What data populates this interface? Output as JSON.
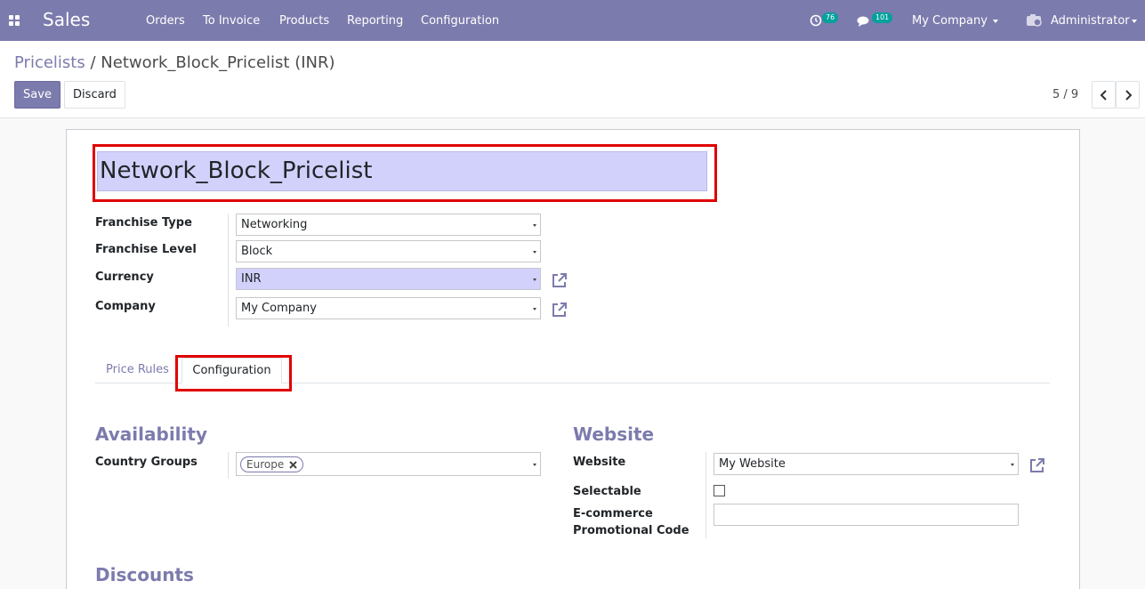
{
  "navbar": {
    "app_name": "Sales",
    "menu": [
      "Orders",
      "To Invoice",
      "Products",
      "Reporting",
      "Configuration"
    ],
    "activity_count": "76",
    "message_count": "101",
    "company": "My Company",
    "user": "Administrator"
  },
  "breadcrumb": {
    "parent": "Pricelists",
    "separator": "/",
    "current": "Network_Block_Pricelist (INR)"
  },
  "toolbar": {
    "save_label": "Save",
    "discard_label": "Discard"
  },
  "pager": {
    "value": "5 / 9"
  },
  "form": {
    "name": "Network_Block_Pricelist",
    "fields": {
      "franchise_type": {
        "label": "Franchise Type",
        "value": "Networking"
      },
      "franchise_level": {
        "label": "Franchise Level",
        "value": "Block"
      },
      "currency": {
        "label": "Currency",
        "value": "INR"
      },
      "company": {
        "label": "Company",
        "value": "My Company"
      }
    }
  },
  "tabs": [
    {
      "label": "Price Rules",
      "active": false
    },
    {
      "label": "Configuration",
      "active": true
    }
  ],
  "availability": {
    "title": "Availability",
    "country_groups_label": "Country Groups",
    "country_group_tag": "Europe"
  },
  "website_section": {
    "title": "Website",
    "website_label": "Website",
    "website_value": "My Website",
    "selectable_label": "Selectable",
    "selectable_checked": false,
    "promo_label_line1": "E-commerce",
    "promo_label_line2": "Promotional Code",
    "promo_value": ""
  },
  "discounts": {
    "title": "Discounts"
  },
  "colors": {
    "brand": "#7c7bad",
    "highlight_field": "#d2d1fb",
    "annotation_red": "#e00000",
    "badge_teal": "#00a09d"
  }
}
